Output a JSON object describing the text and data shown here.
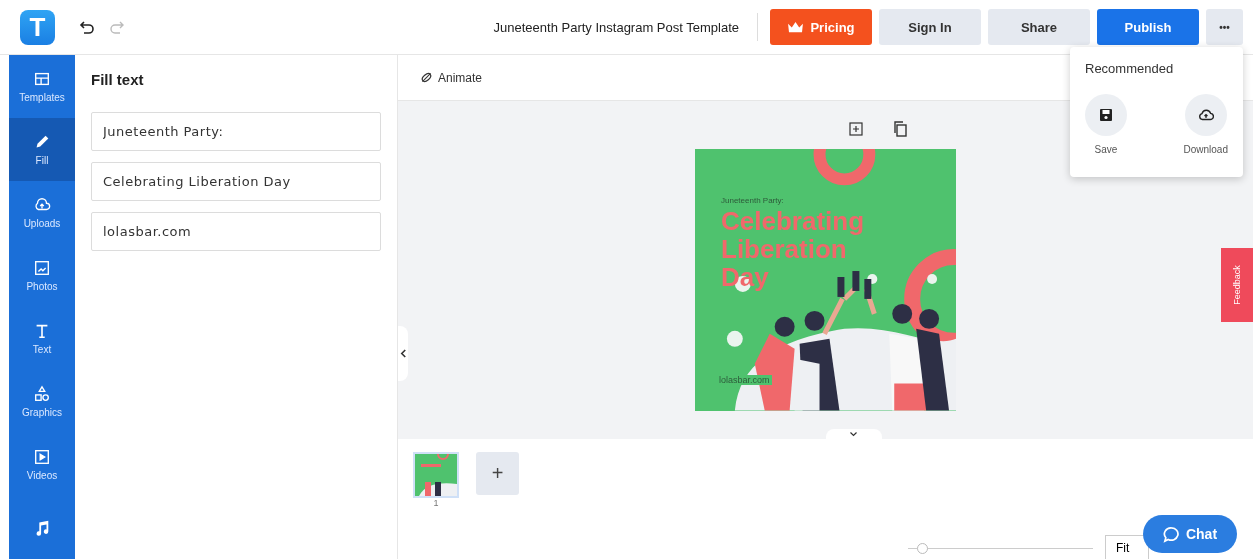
{
  "app": {
    "logo_letter": "T",
    "redo_disabled": true
  },
  "header": {
    "title": "Juneteenth Party Instagram Post Template",
    "buttons": [
      {
        "label": "Pricing",
        "kind": "pricing"
      },
      {
        "label": "Sign In",
        "kind": "plain"
      },
      {
        "label": "Share",
        "kind": "plain"
      },
      {
        "label": "Publish",
        "kind": "primary"
      },
      {
        "label": "•••",
        "kind": "more"
      }
    ]
  },
  "nav": [
    {
      "label": "Templates",
      "kind": "templates",
      "selected": false
    },
    {
      "label": "Fill",
      "kind": "fill",
      "selected": true
    },
    {
      "label": "Uploads",
      "kind": "upload",
      "selected": false
    },
    {
      "label": "Photos",
      "kind": "photo",
      "selected": false
    },
    {
      "label": "Text",
      "kind": "text",
      "selected": false
    },
    {
      "label": "Graphics",
      "kind": "graphics",
      "selected": false
    },
    {
      "label": "Videos",
      "kind": "video",
      "selected": false
    },
    {
      "kind": "audio",
      "selected": false
    }
  ],
  "fill_panel": {
    "title": "Fill text",
    "fields": [
      {
        "value": "Juneteenth Party:"
      },
      {
        "value": "Celebrating Liberation Day"
      },
      {
        "value": "lolasbar.com"
      }
    ]
  },
  "toolbar": {
    "animate": "Animate"
  },
  "design": {
    "subtitle": "Juneteenth Party:",
    "headline": "Celebrating Liberation Day",
    "footer": "lolasbar.com"
  },
  "pages": [
    {
      "number": "1",
      "selected": true
    }
  ],
  "add_page": "+",
  "zoom": {
    "level": 0.05,
    "fit": "Fit"
  },
  "chat": "Chat",
  "feedback": "Feedback",
  "menu": {
    "heading": "Recommended",
    "items": [
      {
        "label": "Save",
        "kind": "save"
      },
      {
        "label": "Download",
        "kind": "download"
      }
    ]
  }
}
